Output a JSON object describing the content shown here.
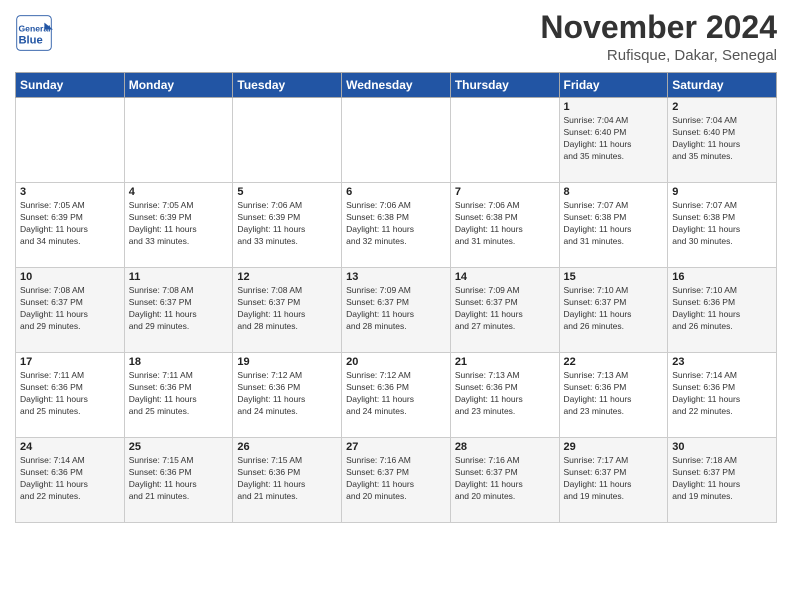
{
  "header": {
    "logo_general": "General",
    "logo_blue": "Blue",
    "month_title": "November 2024",
    "location": "Rufisque, Dakar, Senegal"
  },
  "weekdays": [
    "Sunday",
    "Monday",
    "Tuesday",
    "Wednesday",
    "Thursday",
    "Friday",
    "Saturday"
  ],
  "weeks": [
    [
      {
        "day": "",
        "info": ""
      },
      {
        "day": "",
        "info": ""
      },
      {
        "day": "",
        "info": ""
      },
      {
        "day": "",
        "info": ""
      },
      {
        "day": "",
        "info": ""
      },
      {
        "day": "1",
        "info": "Sunrise: 7:04 AM\nSunset: 6:40 PM\nDaylight: 11 hours\nand 35 minutes."
      },
      {
        "day": "2",
        "info": "Sunrise: 7:04 AM\nSunset: 6:40 PM\nDaylight: 11 hours\nand 35 minutes."
      }
    ],
    [
      {
        "day": "3",
        "info": "Sunrise: 7:05 AM\nSunset: 6:39 PM\nDaylight: 11 hours\nand 34 minutes."
      },
      {
        "day": "4",
        "info": "Sunrise: 7:05 AM\nSunset: 6:39 PM\nDaylight: 11 hours\nand 33 minutes."
      },
      {
        "day": "5",
        "info": "Sunrise: 7:06 AM\nSunset: 6:39 PM\nDaylight: 11 hours\nand 33 minutes."
      },
      {
        "day": "6",
        "info": "Sunrise: 7:06 AM\nSunset: 6:38 PM\nDaylight: 11 hours\nand 32 minutes."
      },
      {
        "day": "7",
        "info": "Sunrise: 7:06 AM\nSunset: 6:38 PM\nDaylight: 11 hours\nand 31 minutes."
      },
      {
        "day": "8",
        "info": "Sunrise: 7:07 AM\nSunset: 6:38 PM\nDaylight: 11 hours\nand 31 minutes."
      },
      {
        "day": "9",
        "info": "Sunrise: 7:07 AM\nSunset: 6:38 PM\nDaylight: 11 hours\nand 30 minutes."
      }
    ],
    [
      {
        "day": "10",
        "info": "Sunrise: 7:08 AM\nSunset: 6:37 PM\nDaylight: 11 hours\nand 29 minutes."
      },
      {
        "day": "11",
        "info": "Sunrise: 7:08 AM\nSunset: 6:37 PM\nDaylight: 11 hours\nand 29 minutes."
      },
      {
        "day": "12",
        "info": "Sunrise: 7:08 AM\nSunset: 6:37 PM\nDaylight: 11 hours\nand 28 minutes."
      },
      {
        "day": "13",
        "info": "Sunrise: 7:09 AM\nSunset: 6:37 PM\nDaylight: 11 hours\nand 28 minutes."
      },
      {
        "day": "14",
        "info": "Sunrise: 7:09 AM\nSunset: 6:37 PM\nDaylight: 11 hours\nand 27 minutes."
      },
      {
        "day": "15",
        "info": "Sunrise: 7:10 AM\nSunset: 6:37 PM\nDaylight: 11 hours\nand 26 minutes."
      },
      {
        "day": "16",
        "info": "Sunrise: 7:10 AM\nSunset: 6:36 PM\nDaylight: 11 hours\nand 26 minutes."
      }
    ],
    [
      {
        "day": "17",
        "info": "Sunrise: 7:11 AM\nSunset: 6:36 PM\nDaylight: 11 hours\nand 25 minutes."
      },
      {
        "day": "18",
        "info": "Sunrise: 7:11 AM\nSunset: 6:36 PM\nDaylight: 11 hours\nand 25 minutes."
      },
      {
        "day": "19",
        "info": "Sunrise: 7:12 AM\nSunset: 6:36 PM\nDaylight: 11 hours\nand 24 minutes."
      },
      {
        "day": "20",
        "info": "Sunrise: 7:12 AM\nSunset: 6:36 PM\nDaylight: 11 hours\nand 24 minutes."
      },
      {
        "day": "21",
        "info": "Sunrise: 7:13 AM\nSunset: 6:36 PM\nDaylight: 11 hours\nand 23 minutes."
      },
      {
        "day": "22",
        "info": "Sunrise: 7:13 AM\nSunset: 6:36 PM\nDaylight: 11 hours\nand 23 minutes."
      },
      {
        "day": "23",
        "info": "Sunrise: 7:14 AM\nSunset: 6:36 PM\nDaylight: 11 hours\nand 22 minutes."
      }
    ],
    [
      {
        "day": "24",
        "info": "Sunrise: 7:14 AM\nSunset: 6:36 PM\nDaylight: 11 hours\nand 22 minutes."
      },
      {
        "day": "25",
        "info": "Sunrise: 7:15 AM\nSunset: 6:36 PM\nDaylight: 11 hours\nand 21 minutes."
      },
      {
        "day": "26",
        "info": "Sunrise: 7:15 AM\nSunset: 6:36 PM\nDaylight: 11 hours\nand 21 minutes."
      },
      {
        "day": "27",
        "info": "Sunrise: 7:16 AM\nSunset: 6:37 PM\nDaylight: 11 hours\nand 20 minutes."
      },
      {
        "day": "28",
        "info": "Sunrise: 7:16 AM\nSunset: 6:37 PM\nDaylight: 11 hours\nand 20 minutes."
      },
      {
        "day": "29",
        "info": "Sunrise: 7:17 AM\nSunset: 6:37 PM\nDaylight: 11 hours\nand 19 minutes."
      },
      {
        "day": "30",
        "info": "Sunrise: 7:18 AM\nSunset: 6:37 PM\nDaylight: 11 hours\nand 19 minutes."
      }
    ]
  ]
}
